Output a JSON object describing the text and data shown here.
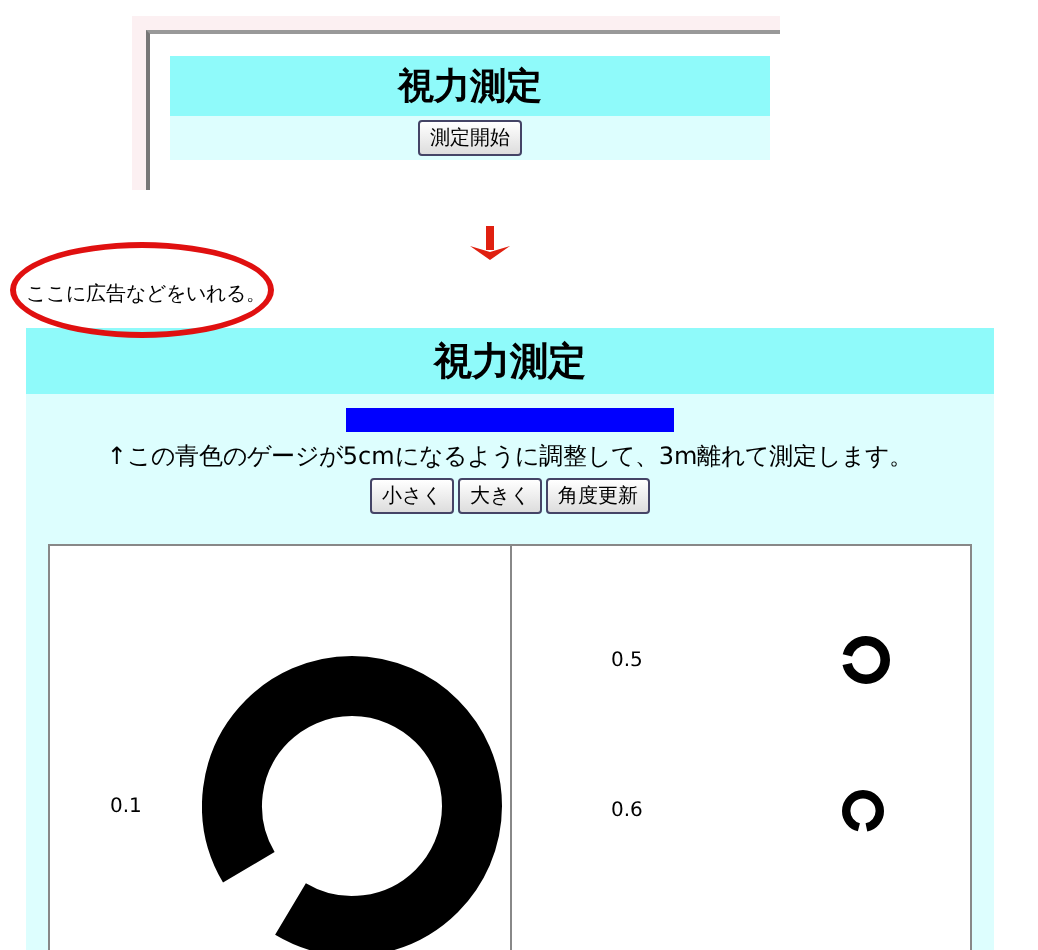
{
  "preview": {
    "title": "視力測定",
    "start_button": "測定開始"
  },
  "ad_note": "ここに広告などをいれる。",
  "header": {
    "title": "視力測定"
  },
  "gauge": {
    "instruction": "↑この青色のゲージが5cmになるように調整して、3m離れて測定します。"
  },
  "buttons": [
    "小さく",
    "大きく",
    "角度更新"
  ],
  "chart_left": [
    {
      "label": "0.1"
    }
  ],
  "chart_right": [
    {
      "label": "0.5"
    },
    {
      "label": "0.6"
    }
  ]
}
